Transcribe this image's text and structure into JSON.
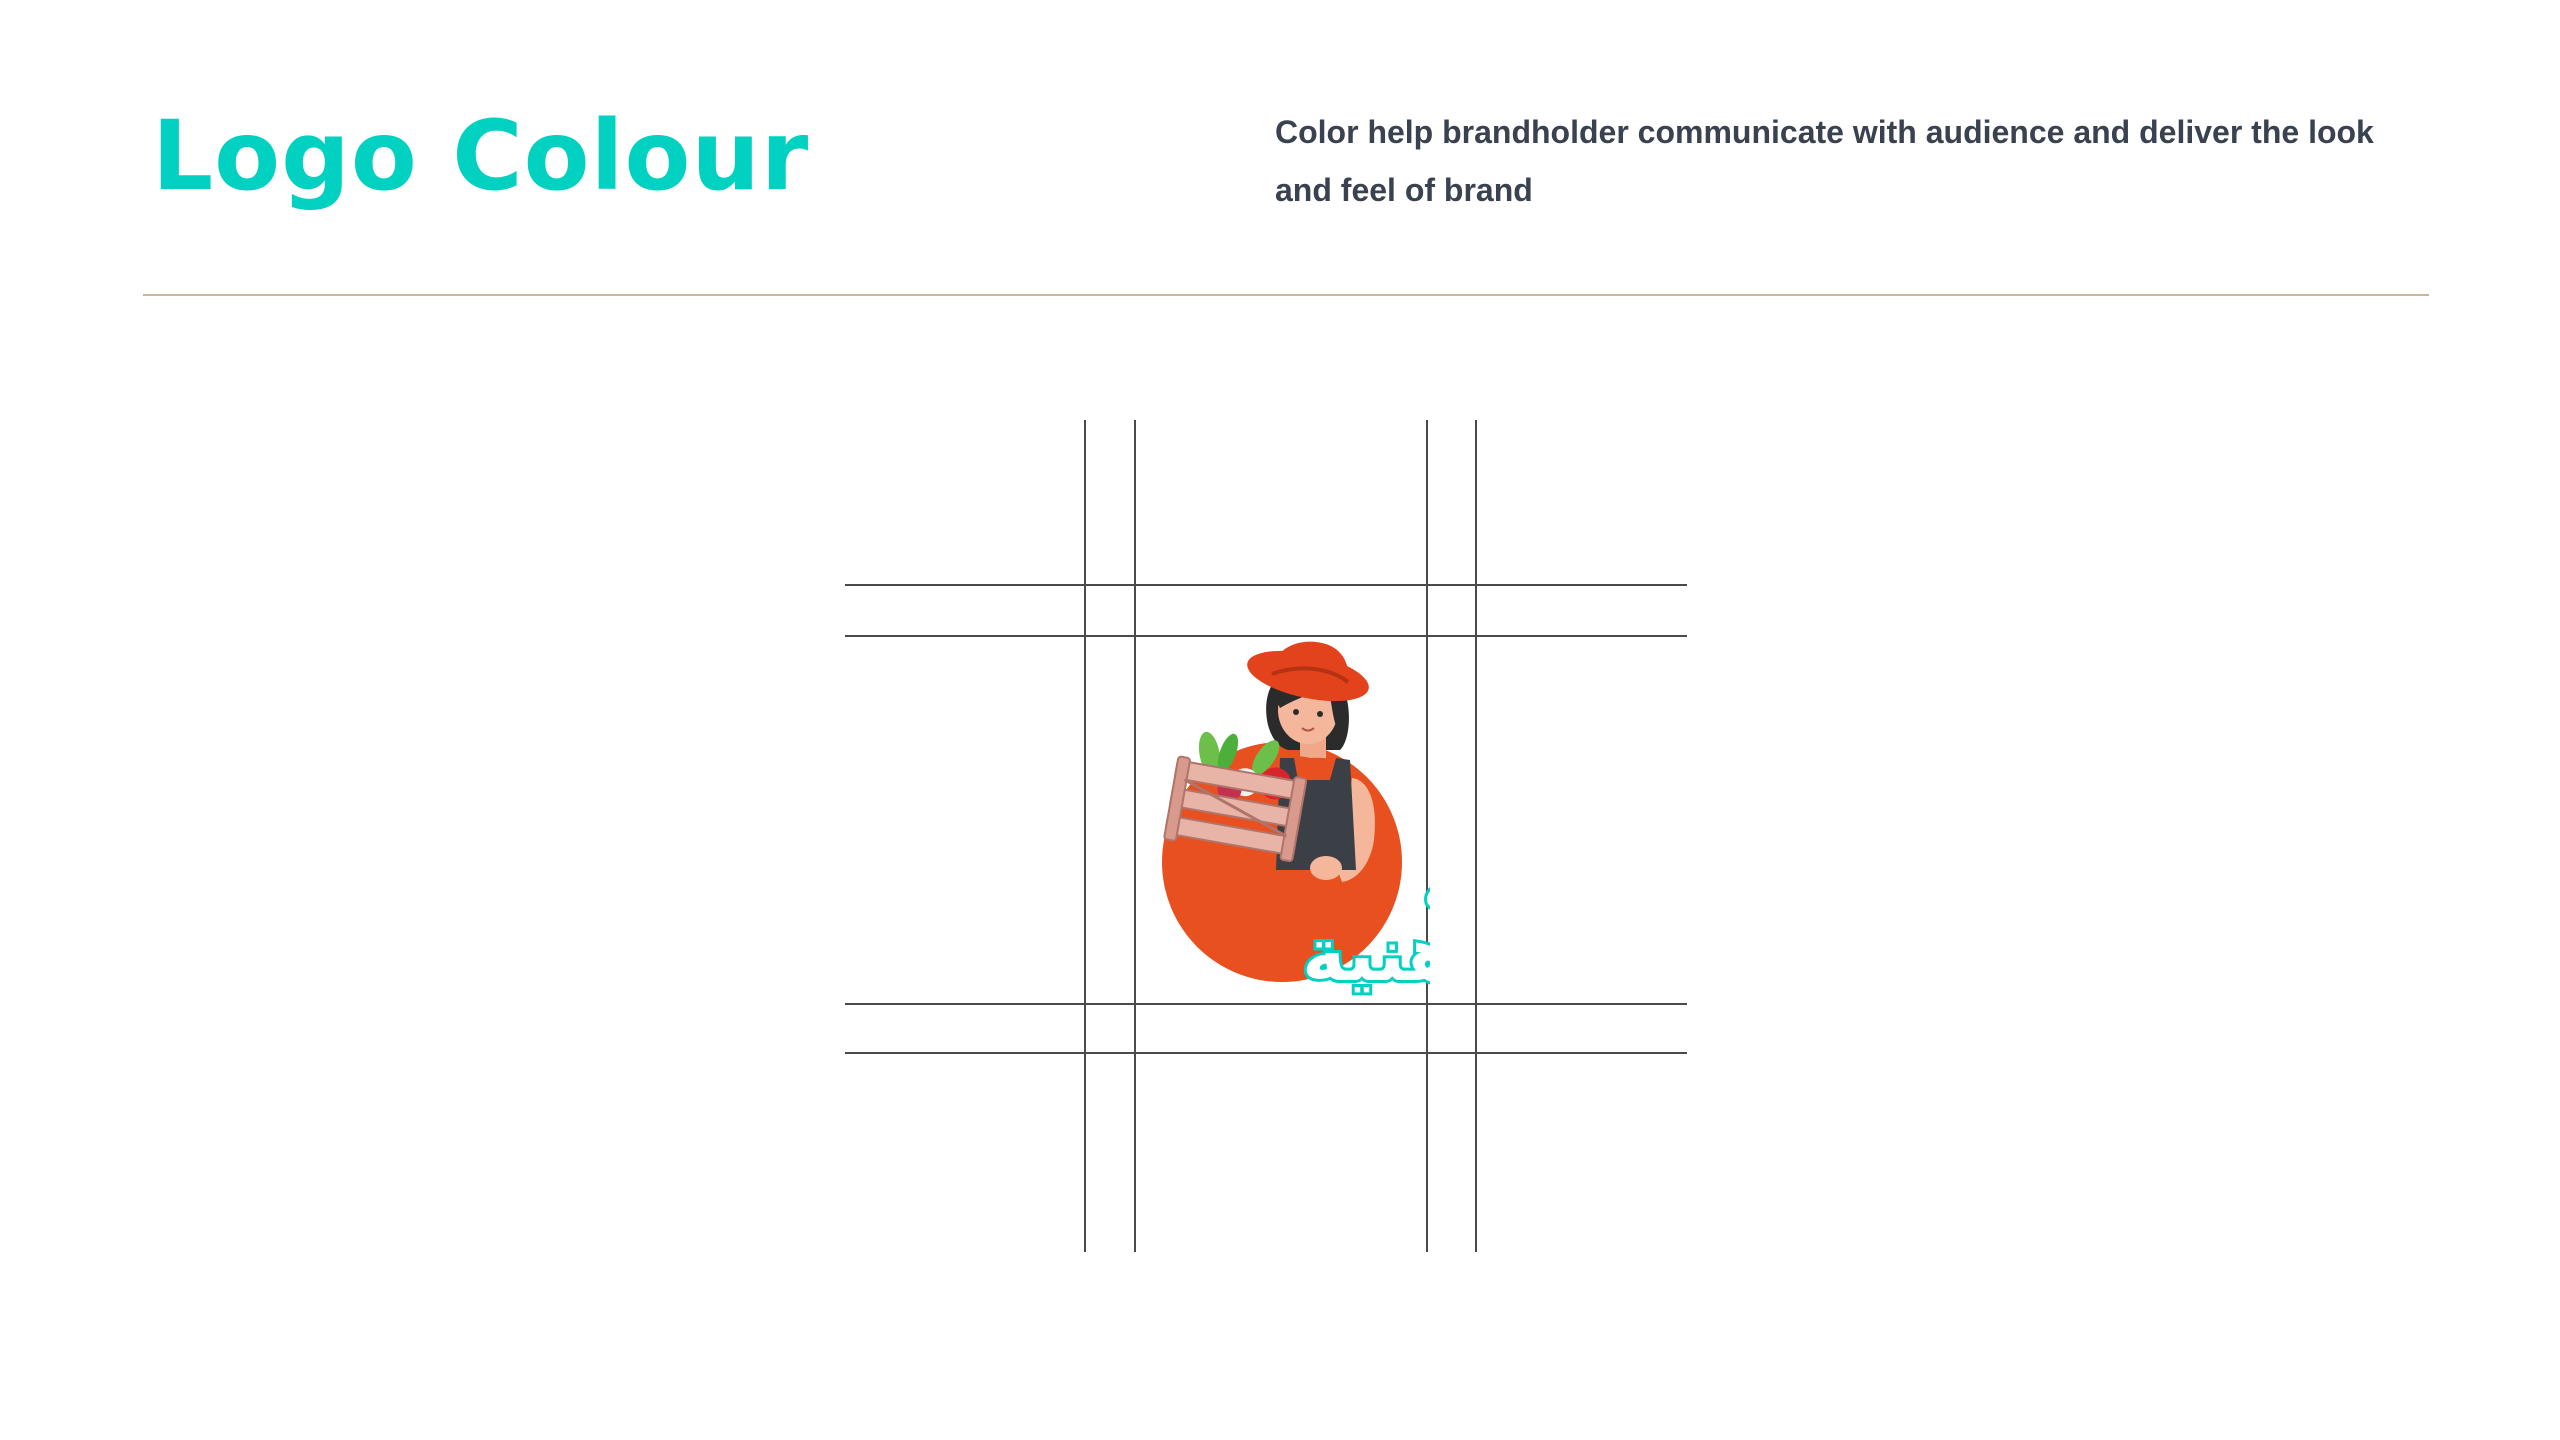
{
  "header": {
    "title": "Logo Colour",
    "description": "Color help brandholder communicate with audience and deliver the look and feel of brand"
  },
  "logo": {
    "wordmark": "أكلة هنية",
    "colors": {
      "accent": "#00d1c1",
      "circle": "#e8501f",
      "hat": "#e3431c",
      "crate": "#e8b4a8",
      "overall": "#3b3f46",
      "skin": "#f5b79c"
    }
  },
  "colors": {
    "title": "#00d1c1",
    "text": "#3a4250",
    "divider": "#cdb49a",
    "grid": "#4a4a4a"
  }
}
